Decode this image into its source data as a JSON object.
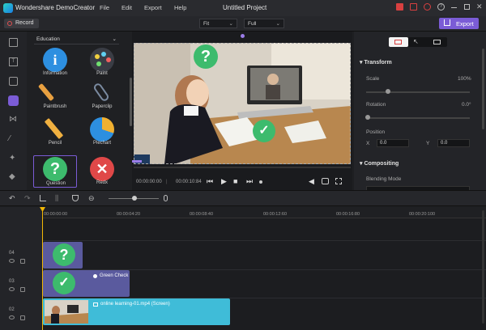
{
  "app": {
    "name": "Wondershare DemoCreator",
    "project_title": "Untitled Project"
  },
  "menu": [
    "File",
    "Edit",
    "Export",
    "Help"
  ],
  "toolbar": {
    "record_label": "Record",
    "fit_value": "Fit",
    "quality_value": "Full",
    "export_label": "Export"
  },
  "library": {
    "category": "Education",
    "items": [
      {
        "label": "Information",
        "icon": "info-icon",
        "color": "#2d8fe0"
      },
      {
        "label": "Paint",
        "icon": "paint-palette-icon",
        "color": "#3a3d45"
      },
      {
        "label": "Paintbrush",
        "icon": "paintbrush-icon",
        "color": "#e8a040"
      },
      {
        "label": "Paperclip",
        "icon": "paperclip-icon",
        "color": "#7a8aa0"
      },
      {
        "label": "Pencil",
        "icon": "pencil-icon",
        "color": "#f0b040"
      },
      {
        "label": "Piechart",
        "icon": "piechart-icon",
        "color": "#2d8fe0"
      },
      {
        "label": "Question",
        "icon": "question-icon",
        "color": "#3dbb6d"
      },
      {
        "label": "Redx",
        "icon": "red-x-icon",
        "color": "#e04848"
      }
    ]
  },
  "player": {
    "current_time": "00:00:00:00",
    "total_time": "00:00:10:84"
  },
  "properties": {
    "transform_title": "Transform",
    "scale_label": "Scale",
    "scale_value": "100%",
    "rotation_label": "Rotation",
    "rotation_value": "0.0°",
    "position_label": "Position",
    "x_label": "X",
    "x_value": "0.0",
    "y_label": "Y",
    "y_value": "0.0",
    "compositing_title": "Compositing",
    "blending_label": "Blending Mode"
  },
  "timeline": {
    "ruler": [
      "00:00:00:00",
      "00:00:04:20",
      "00:00:08:40",
      "00:00:12:60",
      "00:00:16:80",
      "00:00:20:100"
    ],
    "tracks": [
      {
        "num": "04",
        "clip_label": ""
      },
      {
        "num": "03",
        "clip_label": "Green Check"
      },
      {
        "num": "02",
        "clip_label": "online learning-01.mp4 (Screen)"
      }
    ]
  },
  "colors": {
    "accent": "#7b5cd6",
    "clip_purple": "#5a5a9e",
    "clip_video": "#3fbcd8",
    "playhead": "#f2b705"
  }
}
